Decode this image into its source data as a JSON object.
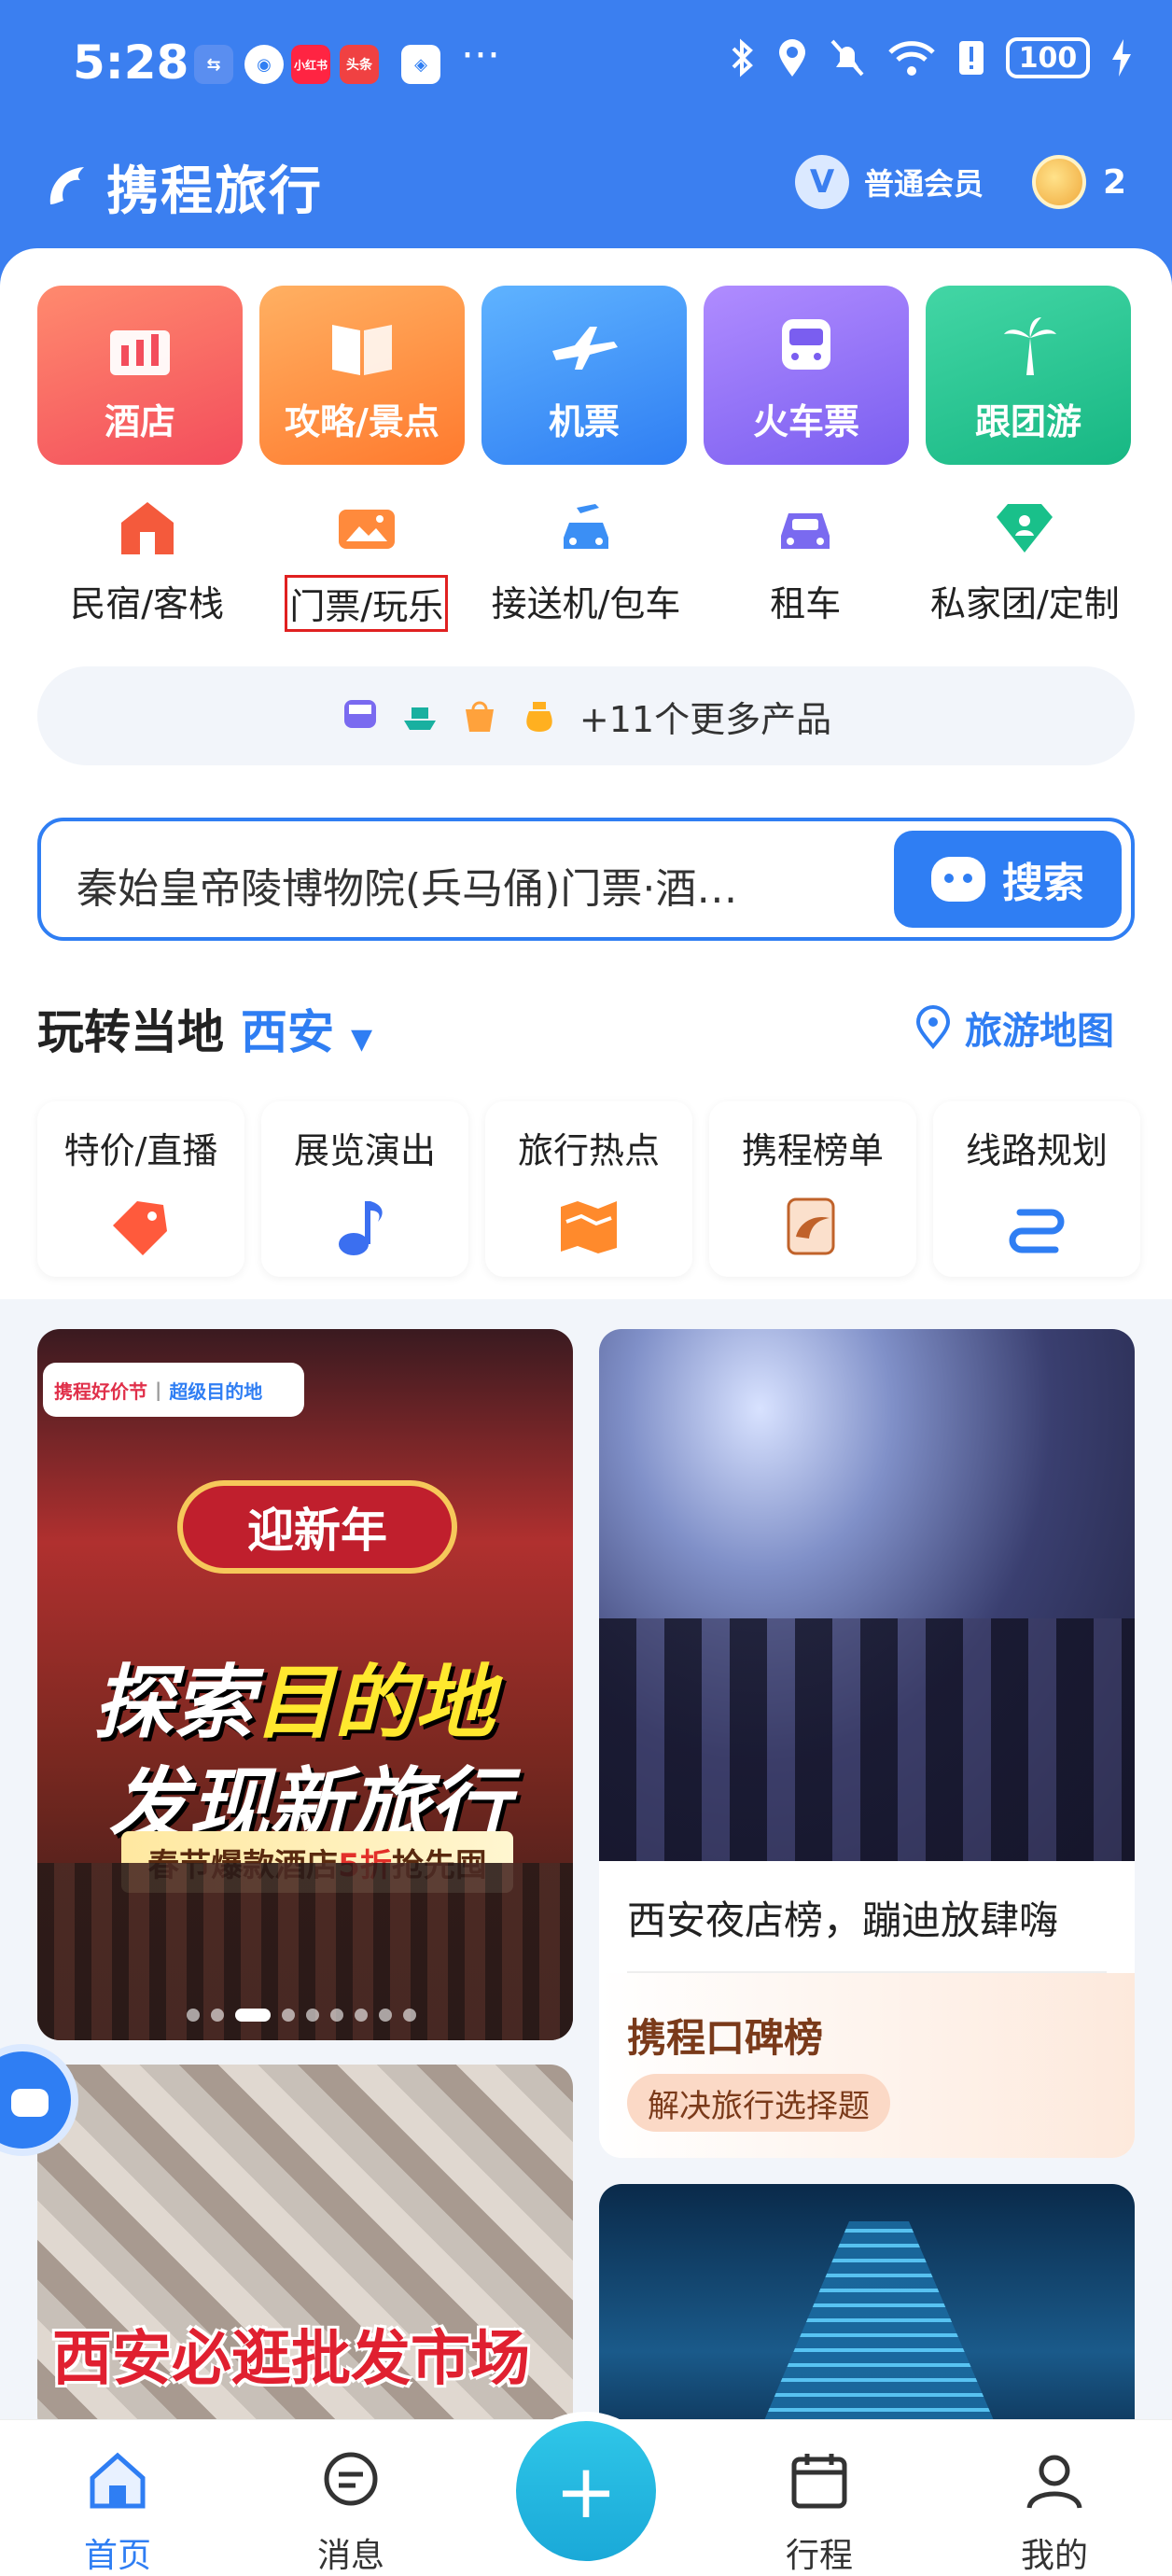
{
  "status_bar": {
    "time": "5:28",
    "notif_icons": [
      "usb-icon",
      "vpn-icon",
      "xiaohongshu-icon",
      "toutiao-icon",
      "app-icon"
    ],
    "notif_labels": {
      "xhs": "小红书",
      "toutiao": "头条"
    },
    "more": "···",
    "battery": "100"
  },
  "header": {
    "brand": "携程旅行",
    "member_badge": "V",
    "member_label": "普通会员",
    "coin_count": "2"
  },
  "top_cards": [
    {
      "label": "酒店",
      "icon": "hotel-icon"
    },
    {
      "label": "攻略/景点",
      "icon": "guide-book-icon"
    },
    {
      "label": "机票",
      "icon": "airplane-icon"
    },
    {
      "label": "火车票",
      "icon": "train-icon"
    },
    {
      "label": "跟团游",
      "icon": "palm-tree-icon"
    }
  ],
  "sub_items": [
    {
      "label": "民宿/客栈",
      "icon": "homestay-icon"
    },
    {
      "label": "门票/玩乐",
      "icon": "ticket-icon"
    },
    {
      "label": "接送机/包车",
      "icon": "airport-car-icon"
    },
    {
      "label": "租车",
      "icon": "car-rental-icon"
    },
    {
      "label": "私家团/定制",
      "icon": "custom-tour-icon"
    }
  ],
  "more_products": "+11个更多产品",
  "search": {
    "text": "秦始皇帝陵博物院(兵马俑)门票·酒…",
    "button": "搜索"
  },
  "local": {
    "title": "玩转当地",
    "city": "西安",
    "map_link": "旅游地图"
  },
  "features": [
    {
      "label": "特价/直播",
      "icon": "price-tag-icon"
    },
    {
      "label": "展览演出",
      "icon": "music-note-icon"
    },
    {
      "label": "旅行热点",
      "icon": "hot-map-icon"
    },
    {
      "label": "携程榜单",
      "icon": "ranking-icon"
    },
    {
      "label": "线路规划",
      "icon": "route-icon"
    }
  ],
  "banner": {
    "chip_left": "携程好价节",
    "chip_right": "超级目的地",
    "sign": "迎新年",
    "line1_a": "探索",
    "line1_b": "目的地",
    "line2": "发现新旅行",
    "sub_a": "春节爆款酒店",
    "sub_b": "5折",
    "sub_c": "抢先囤"
  },
  "card2": {
    "title": "西安夜店榜，蹦迪放肆嗨",
    "brand": "携程口碑榜",
    "tag": "解决旅行选择题"
  },
  "card3": {
    "title": "西安必逛批发市场"
  },
  "tabs": [
    {
      "label": "首页",
      "icon": "home-icon"
    },
    {
      "label": "消息",
      "icon": "message-icon"
    },
    {
      "label": "行程",
      "icon": "itinerary-icon"
    },
    {
      "label": "我的",
      "icon": "profile-icon"
    }
  ],
  "plus": "+",
  "colors": {
    "primary": "#3b7ff0",
    "accent": "#2f7ef3"
  }
}
